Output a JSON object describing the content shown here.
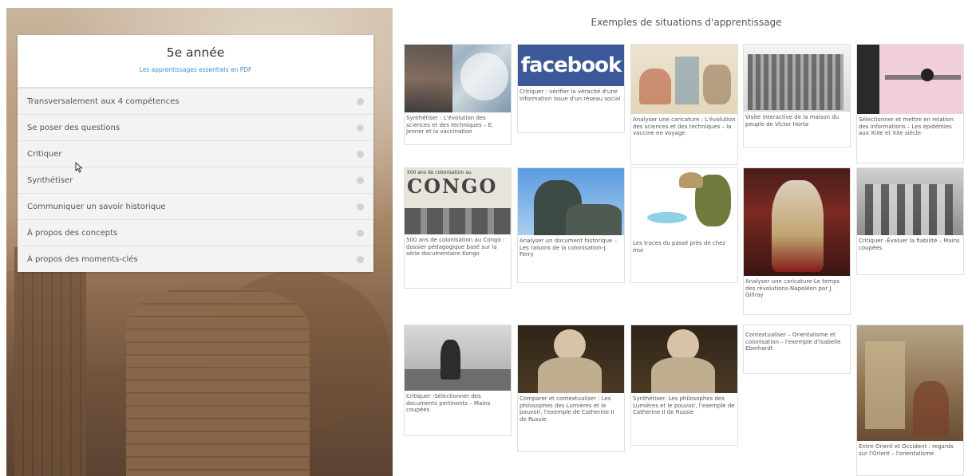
{
  "panel": {
    "title": "5e année",
    "pdf_link": "Les apprentissages essentiels en PDF",
    "items": [
      {
        "label": "Transversalement aux 4 compétences"
      },
      {
        "label": "Se poser des questions"
      },
      {
        "label": "Critiquer"
      },
      {
        "label": "Synthétiser"
      },
      {
        "label": "Communiquer un savoir historique"
      },
      {
        "label": "À propos des concepts"
      },
      {
        "label": "À propos des moments-clés"
      }
    ]
  },
  "gallery": {
    "title": "Exemples de situations d'apprentissage",
    "cards": [
      {
        "caption": "Synthétiser : L'évolution des sciences et des techniques – E. Jenner et la vaccination"
      },
      {
        "caption": "Critiquer : vérifier la véracité d'une information issue d'un réseau social",
        "thumb_text": "facebook"
      },
      {
        "caption": "Analyser une caricature : L'évolution des sciences et des techniques – la vaccine en voyage"
      },
      {
        "caption": "Visite interactive de la maison du peuple de Victor Horta"
      },
      {
        "caption": "Sélectionner et mettre en relation des informations – Les épidémies aux XIXe et XXe siècle"
      },
      {
        "caption": "500 ans de colonisation au Congo : dossier pédagogique basé sur la série documentaire Kongo",
        "thumb_text": "500 ans de colonisation au",
        "thumb_text2": "CONGO"
      },
      {
        "caption": "Analyser un document historique – Les raisons de la colonisation-J. Ferry"
      },
      {
        "caption": "Les traces du passé près de chez moi"
      },
      {
        "caption": "Analyser une caricature-Le temps des révolutions-Napoléon par J. Gillray"
      },
      {
        "caption": "Critiquer -Évaluer la fiabilité – Mains coupées"
      },
      {
        "caption": "Critiquer -Sélectionner des documents pertinents – Mains coupées"
      },
      {
        "caption": "Comparer et contextualiser : Les philosophes des Lumières et le pouvoir, l'exemple de Catherine II de Russie"
      },
      {
        "caption": "Synthétiser: Les philosophes des Lumières et le pouvoir, l'exemple de Catherine II de Russie"
      },
      {
        "caption": "Contextualiser – Orientalisme et colonisation – l'exemple d'Isabelle Eberhardt"
      },
      {
        "caption": "Entre Orient et Occident : regards sur l'Orient – l'orientalisme"
      }
    ]
  }
}
